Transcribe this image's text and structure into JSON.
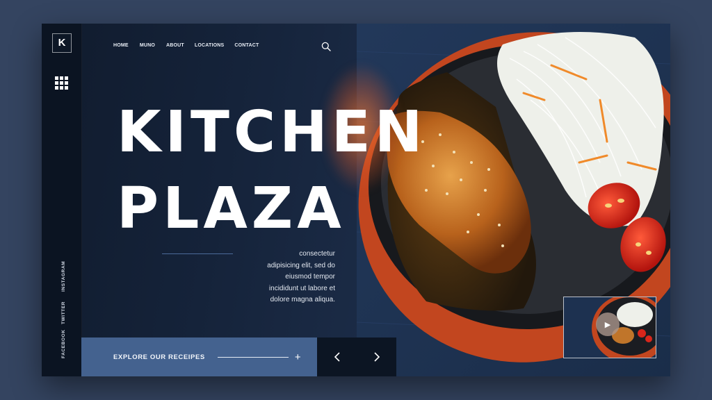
{
  "logo": {
    "letter": "K"
  },
  "nav": {
    "items": [
      "HOME",
      "MUNO",
      "ABOUT",
      "LOCATIONS",
      "CONTACT"
    ]
  },
  "icons": {
    "search": "search-icon",
    "menu": "grid-icon",
    "play": "play-icon",
    "prev": "chevron-left-icon",
    "next": "chevron-right-icon",
    "add": "plus-icon"
  },
  "social": {
    "items": [
      "INSTAGRAM",
      "TWITTER",
      "FACEBOOK"
    ]
  },
  "hero": {
    "title_line1": "KITCHEN",
    "title_line2": "PLAZA",
    "description_lines": [
      "consectetur",
      "adipisicing elit, sed do",
      "eiusmod tempor",
      "incididunt ut labore et",
      "dolore magna aliqua."
    ]
  },
  "cta": {
    "label": "EXPLORE OUR RECEIPES",
    "plus": "+"
  },
  "slider": {
    "prev": "‹",
    "next": "›"
  },
  "video": {
    "play": "▶"
  },
  "colors": {
    "background": "#344460",
    "panel": "#101b2d",
    "accent": "#44628f",
    "glow": "#f07832"
  }
}
